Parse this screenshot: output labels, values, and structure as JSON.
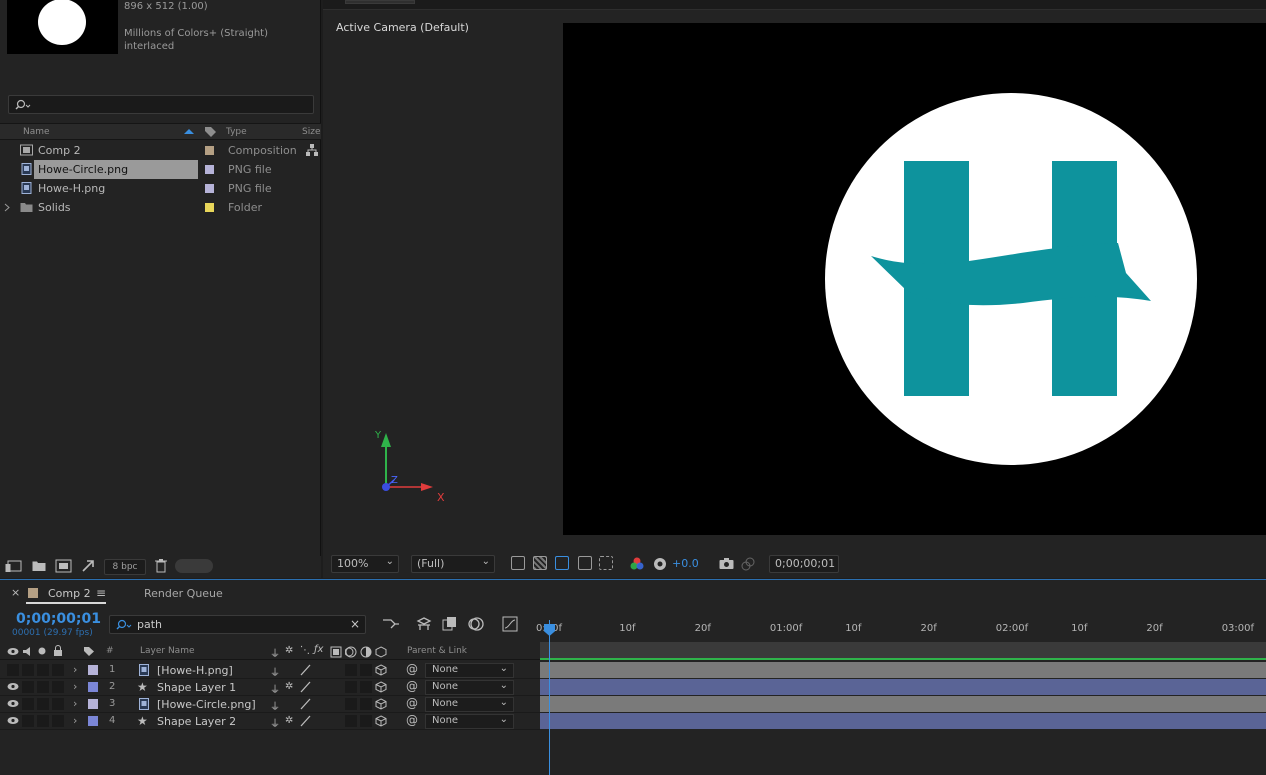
{
  "project": {
    "info": {
      "dimensions": "896 x 512 (1.00)",
      "colors": "Millions of Colors+ (Straight)",
      "field": "interlaced"
    },
    "columns": {
      "name": "Name",
      "type": "Type",
      "size": "Size"
    },
    "items": [
      {
        "name": "Comp 2",
        "type": "Composition",
        "color": "#b5a084",
        "icon": "composition-icon"
      },
      {
        "name": "Howe-Circle.png",
        "type": "PNG file",
        "color": "#b6b3d8",
        "icon": "png-file-icon"
      },
      {
        "name": "Howe-H.png",
        "type": "PNG file",
        "color": "#b6b3d8",
        "icon": "png-file-icon"
      },
      {
        "name": "Solids",
        "type": "Folder",
        "color": "#e8d65a",
        "icon": "folder-icon"
      }
    ],
    "footer": {
      "bpc": "8 bpc"
    }
  },
  "viewer": {
    "camera_label": "Active Camera (Default)",
    "axes": {
      "x": "X",
      "y": "Y",
      "z": "Z"
    },
    "zoom": "100%",
    "resolution": "(Full)",
    "exposure": "+0.0",
    "timecode": "0;00;00;01",
    "logo_color": "#0e939d"
  },
  "timeline": {
    "tabs": {
      "close": "×",
      "comp": "Comp 2",
      "menu": "≡",
      "render_queue": "Render Queue"
    },
    "timecode": "0;00;00;01",
    "frames": "00001 (29.97 fps)",
    "search_value": "path",
    "search_clear": "×",
    "header": {
      "number": "#",
      "layer_name": "Layer Name",
      "parent": "Parent & Link"
    },
    "ruler": [
      "0:00f",
      "10f",
      "20f",
      "01:00f",
      "10f",
      "20f",
      "02:00f",
      "10f",
      "20f",
      "03:00f"
    ],
    "layers": [
      {
        "num": "1",
        "name": "[Howe-H.png]",
        "parent": "None",
        "color": "#b6b3d8",
        "type": "footage",
        "visible": false,
        "bar": "#7a7a7a"
      },
      {
        "num": "2",
        "name": "Shape Layer 1",
        "parent": "None",
        "color": "#7b86d6",
        "type": "shape",
        "visible": true,
        "bar": "#5a6496"
      },
      {
        "num": "3",
        "name": "[Howe-Circle.png]",
        "parent": "None",
        "color": "#b6b3d8",
        "type": "footage",
        "visible": true,
        "bar": "#7a7a7a"
      },
      {
        "num": "4",
        "name": "Shape Layer 2",
        "parent": "None",
        "color": "#7b86d6",
        "type": "shape",
        "visible": true,
        "bar": "#5a6496"
      }
    ]
  }
}
